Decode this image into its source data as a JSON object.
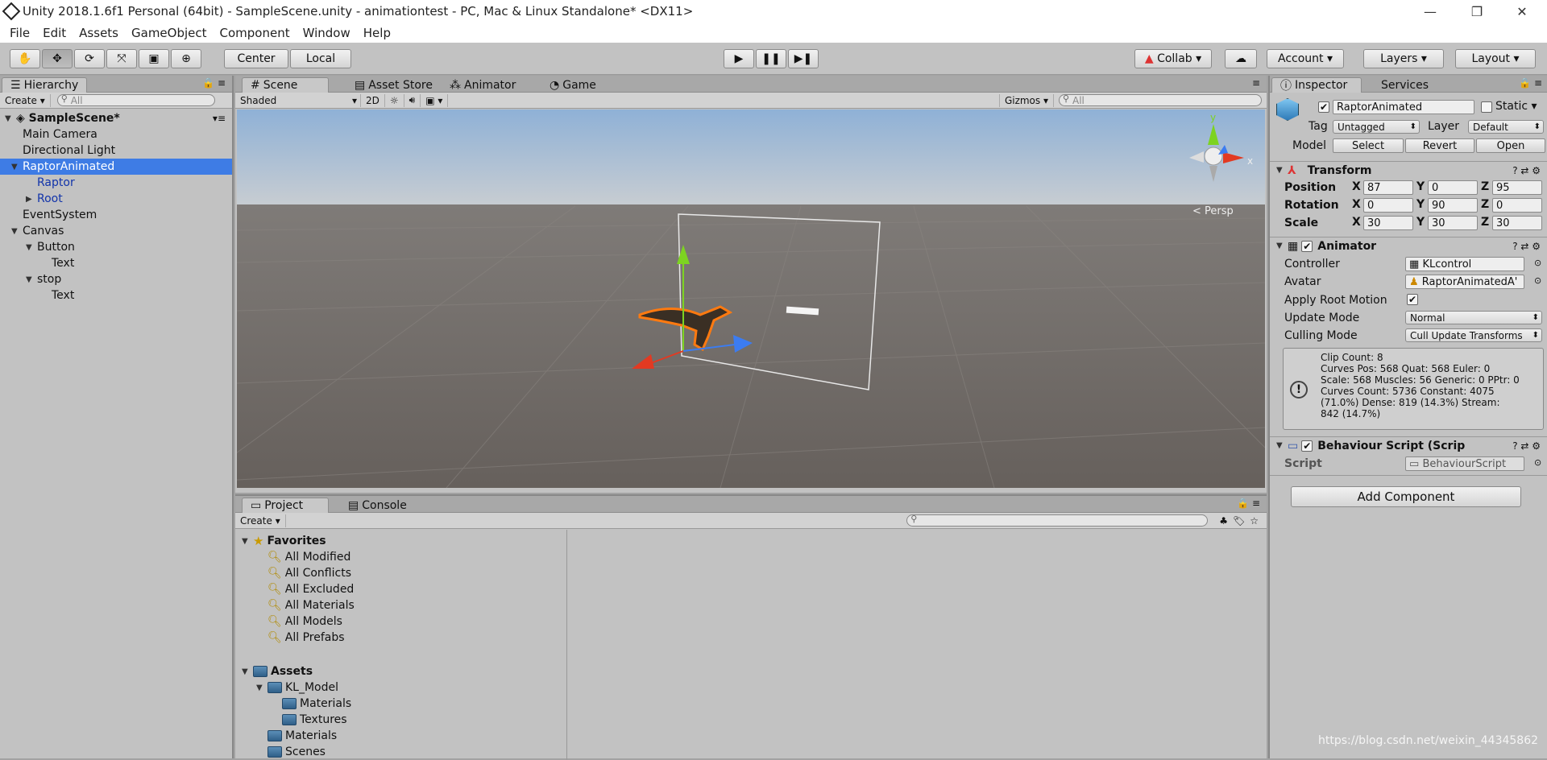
{
  "window": {
    "title": "Unity 2018.1.6f1 Personal (64bit) - SampleScene.unity - animationtest - PC, Mac & Linux Standalone* <DX11>",
    "minimize": "—",
    "restore": "❐",
    "close": "✕"
  },
  "menu": [
    "File",
    "Edit",
    "Assets",
    "GameObject",
    "Component",
    "Window",
    "Help"
  ],
  "toolbar": {
    "tools": [
      "hand-icon",
      "move-icon",
      "rotate-icon",
      "scale-icon",
      "rect-icon",
      "transform-icon"
    ],
    "center": "Center",
    "local": "Local",
    "play": "▶",
    "pause": "❚❚",
    "step": "▶❚",
    "collab": "Collab",
    "account": "Account",
    "layers": "Layers",
    "layout": "Layout"
  },
  "hierarchy": {
    "tab": "Hierarchy",
    "create": "Create",
    "search": "All",
    "scene": "SampleScene*",
    "items": [
      {
        "label": "Main Camera",
        "indent": 1,
        "arrow": "",
        "sel": false,
        "blue": false
      },
      {
        "label": "Directional Light",
        "indent": 1,
        "arrow": "",
        "sel": false,
        "blue": false
      },
      {
        "label": "RaptorAnimated",
        "indent": 1,
        "arrow": "▼",
        "sel": true,
        "blue": true
      },
      {
        "label": "Raptor",
        "indent": 2,
        "arrow": "",
        "sel": false,
        "blue": true
      },
      {
        "label": "Root",
        "indent": 2,
        "arrow": "▶",
        "sel": false,
        "blue": true
      },
      {
        "label": "EventSystem",
        "indent": 1,
        "arrow": "",
        "sel": false,
        "blue": false
      },
      {
        "label": "Canvas",
        "indent": 1,
        "arrow": "▼",
        "sel": false,
        "blue": false
      },
      {
        "label": "Button",
        "indent": 2,
        "arrow": "▼",
        "sel": false,
        "blue": false
      },
      {
        "label": "Text",
        "indent": 3,
        "arrow": "",
        "sel": false,
        "blue": false
      },
      {
        "label": "stop",
        "indent": 2,
        "arrow": "▼",
        "sel": false,
        "blue": false
      },
      {
        "label": "Text",
        "indent": 3,
        "arrow": "",
        "sel": false,
        "blue": false
      }
    ]
  },
  "scene": {
    "tabs": [
      "Scene",
      "Asset Store",
      "Animator",
      "Game"
    ],
    "shaded": "Shaded",
    "mode2d": "2D",
    "gizmos": "Gizmos",
    "search": "All",
    "persp": "< Persp",
    "axis_y": "y",
    "axis_x": "x"
  },
  "project": {
    "tabs": [
      "Project",
      "Console"
    ],
    "create": "Create",
    "favorites": "Favorites",
    "fav_items": [
      "All Modified",
      "All Conflicts",
      "All Excluded",
      "All Materials",
      "All Models",
      "All Prefabs"
    ],
    "assets": "Assets",
    "asset_items": [
      {
        "label": "KL_Model",
        "indent": 1,
        "arrow": "▼"
      },
      {
        "label": "Materials",
        "indent": 2,
        "arrow": ""
      },
      {
        "label": "Textures",
        "indent": 2,
        "arrow": ""
      },
      {
        "label": "Materials",
        "indent": 1,
        "arrow": ""
      },
      {
        "label": "Scenes",
        "indent": 1,
        "arrow": ""
      }
    ]
  },
  "inspector": {
    "tabs": [
      "Inspector",
      "Services"
    ],
    "name": "RaptorAnimated",
    "static": "Static",
    "tag_label": "Tag",
    "tag": "Untagged",
    "layer_label": "Layer",
    "layer": "Default",
    "model_label": "Model",
    "select": "Select",
    "revert": "Revert",
    "open": "Open",
    "transform": {
      "title": "Transform",
      "rows": [
        {
          "label": "Position",
          "x": "87",
          "y": "0",
          "z": "95"
        },
        {
          "label": "Rotation",
          "x": "0",
          "y": "90",
          "z": "0"
        },
        {
          "label": "Scale",
          "x": "30",
          "y": "30",
          "z": "30"
        }
      ]
    },
    "animator": {
      "title": "Animator",
      "controller_label": "Controller",
      "controller": "KLcontrol",
      "avatar_label": "Avatar",
      "avatar": "RaptorAnimatedA'",
      "root_label": "Apply Root Motion",
      "update_label": "Update Mode",
      "update": "Normal",
      "culling_label": "Culling Mode",
      "culling": "Cull Update Transforms",
      "info": [
        "Clip Count: 8",
        "Curves Pos: 568 Quat: 568 Euler: 0",
        "Scale: 568 Muscles: 56 Generic: 0 PPtr: 0",
        "Curves Count: 5736 Constant: 4075",
        "(71.0%) Dense: 819 (14.3%) Stream:",
        "842 (14.7%)"
      ]
    },
    "behaviour": {
      "title": "Behaviour Script (Scrip",
      "script_label": "Script",
      "script": "BehaviourScript"
    },
    "add_component": "Add Component"
  },
  "watermark": "https://blog.csdn.net/weixin_44345862",
  "colors": {
    "selection": "#3e7ce5",
    "panel": "#c2c2c2",
    "sky": "#a9c2dc",
    "ground": "#6f6864"
  }
}
